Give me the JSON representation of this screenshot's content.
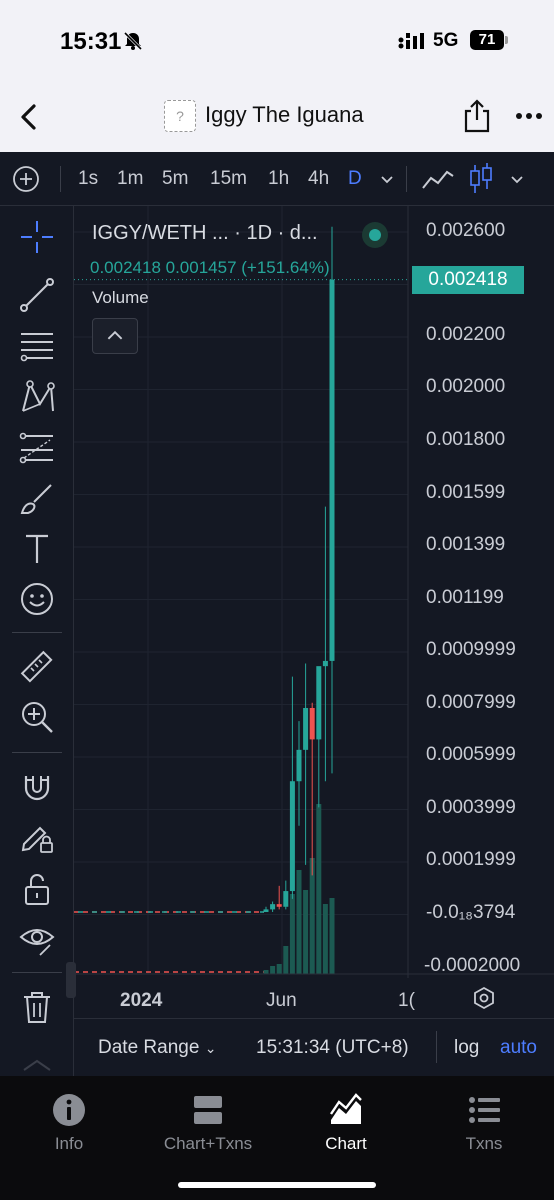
{
  "status_bar": {
    "time": "15:31",
    "network": "5G",
    "battery": "71"
  },
  "header": {
    "token_logo_placeholder": "?",
    "title": "Iggy The Iguana"
  },
  "toolbar": {
    "intervals": [
      {
        "label": "1s",
        "active": false
      },
      {
        "label": "1m",
        "active": false
      },
      {
        "label": "5m",
        "active": false
      },
      {
        "label": "15m",
        "active": false
      },
      {
        "label": "1h",
        "active": false
      },
      {
        "label": "4h",
        "active": false
      },
      {
        "label": "D",
        "active": true
      }
    ]
  },
  "drawing_tools": [
    "crosshair-icon",
    "trend-line-icon",
    "horizontal-lines-icon",
    "pattern-icon",
    "fib-icon",
    "brush-icon",
    "text-icon",
    "emoji-icon",
    "ruler-icon",
    "zoom-in-icon",
    "magnet-icon",
    "lock-drawing-icon",
    "unlock-icon",
    "eye-icon",
    "trash-icon"
  ],
  "legend": {
    "symbol": "IGGY/WETH ...  · 1D · d...",
    "ohlc": "0.002418  0.001457 (+151.64%)",
    "volume_label": "Volume"
  },
  "current_price": "0.002418",
  "chart_data": {
    "type": "candlestick",
    "price_axis_labels": [
      "0.002600",
      "0.002200",
      "0.002000",
      "0.001800",
      "0.001599",
      "0.001399",
      "0.001199",
      "0.0009999",
      "0.0007999",
      "0.0005999",
      "0.0003999",
      "0.0001999",
      "-0.0₁₈3794",
      "-0.0002000"
    ],
    "time_axis_labels": [
      "2024",
      "Jun",
      "1("
    ],
    "last_close": 0.002418,
    "change": 0.001457,
    "change_percent": "+151.64%",
    "candles": [
      {
        "open": 0.0,
        "high": 2e-05,
        "low": 0.0,
        "close": 1e-05,
        "volume": 0.02
      },
      {
        "open": 1e-05,
        "high": 4e-05,
        "low": 0.0,
        "close": 3e-05,
        "volume": 0.04
      },
      {
        "open": 3e-05,
        "high": 0.0001,
        "low": 1e-05,
        "close": 2e-05,
        "volume": 0.05
      },
      {
        "open": 2e-05,
        "high": 0.00012,
        "low": 1e-05,
        "close": 8e-05,
        "volume": 0.14
      },
      {
        "open": 8e-05,
        "high": 0.0009,
        "low": 5e-05,
        "close": 0.0005,
        "volume": 0.4
      },
      {
        "open": 0.0005,
        "high": 0.00073,
        "low": 0.00033,
        "close": 0.00062,
        "volume": 0.52
      },
      {
        "open": 0.00062,
        "high": 0.00095,
        "low": 0.00018,
        "close": 0.00078,
        "volume": 0.42
      },
      {
        "open": 0.00078,
        "high": 0.0008,
        "low": 0.00014,
        "close": 0.00066,
        "volume": 0.58
      },
      {
        "open": 0.00066,
        "high": 0.00088,
        "low": 0.0004,
        "close": 0.00094,
        "volume": 0.85
      },
      {
        "open": 0.00094,
        "high": 0.00155,
        "low": 0.0005,
        "close": 0.00096,
        "volume": 0.35
      },
      {
        "open": 0.00096,
        "high": 0.00262,
        "low": 0.00053,
        "close": 0.002418,
        "volume": 0.38
      }
    ]
  },
  "footer": {
    "date_range": "Date Range",
    "clock": "15:31:34 (UTC+8)",
    "log": "log",
    "auto": "auto"
  },
  "tabs": [
    {
      "label": "Info",
      "active": false
    },
    {
      "label": "Chart+Txns",
      "active": false
    },
    {
      "label": "Chart",
      "active": true
    },
    {
      "label": "Txns",
      "active": false
    }
  ]
}
